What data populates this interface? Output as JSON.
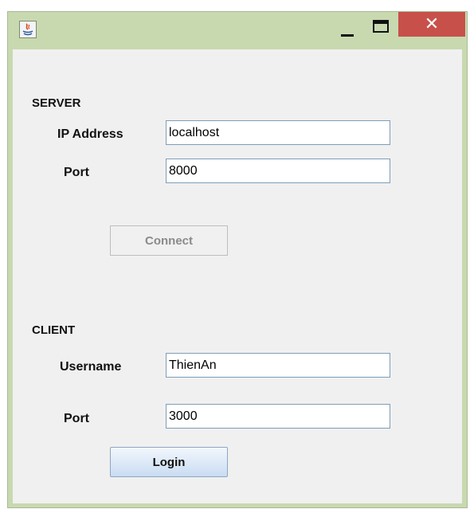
{
  "window": {
    "title": "",
    "close_glyph": "✕",
    "icons": [
      "java-icon",
      "minimize-icon",
      "maximize-icon",
      "close-icon"
    ]
  },
  "server": {
    "section_title": "SERVER",
    "ip_label": "IP Address",
    "ip_value": "localhost",
    "port_label": "Port",
    "port_value": "8000",
    "connect_label": "Connect"
  },
  "client": {
    "section_title": "CLIENT",
    "username_label": "Username",
    "username_value": "ThienAn",
    "port_label": "Port",
    "port_value": "3000",
    "login_label": "Login"
  },
  "colors": {
    "titlebar": "#c8d9b0",
    "close_button": "#c7504a",
    "client_bg": "#f0f0f0"
  }
}
